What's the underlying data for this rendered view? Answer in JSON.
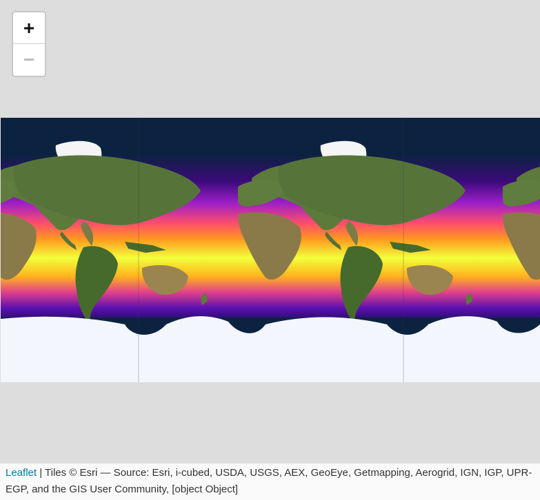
{
  "zoom": {
    "in_label": "+",
    "out_label": "−"
  },
  "attribution": {
    "leaflet_link": "Leaflet",
    "separator": " | ",
    "text": "Tiles © Esri — Source: Esri, i-cubed, USDA, USGS, AEX, GeoEye, Getmapping, Aerogrid, IGN, IGP, UPR-EGP, and the GIS User Community, [object Object]"
  },
  "colors": {
    "ocean_deep": "#0b2340",
    "sst_purple": "#5a10b0",
    "sst_magenta": "#c026c8",
    "sst_orange": "#ff8a1c",
    "sst_yellow": "#f2ff3a",
    "land": "#5d7a3a",
    "ice": "#f3f6fc",
    "leaflet_link": "#0078a8"
  }
}
